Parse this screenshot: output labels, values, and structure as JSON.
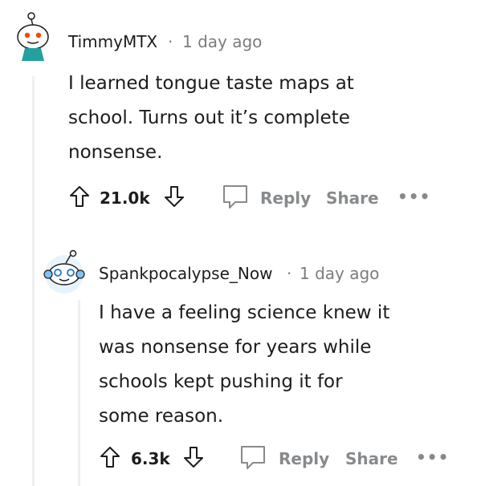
{
  "comments": [
    {
      "username": "TimmyMTX",
      "separator": "·",
      "time": "1 day ago",
      "body_lines": [
        "I learned tongue taste maps at",
        "school. Turns out it’s complete",
        "nonsense."
      ],
      "score": "21.0k",
      "reply_label": "Reply",
      "share_label": "Share",
      "more_label": "•••"
    },
    {
      "username": "Spankpocalypse_Now",
      "separator": "·",
      "time": "1 day ago",
      "body_lines": [
        "I have a feeling science knew it",
        "was nonsense for years while",
        "schools kept pushing it for",
        "some reason."
      ],
      "score": "6.3k",
      "reply_label": "Reply",
      "share_label": "Share",
      "more_label": "•••"
    }
  ]
}
